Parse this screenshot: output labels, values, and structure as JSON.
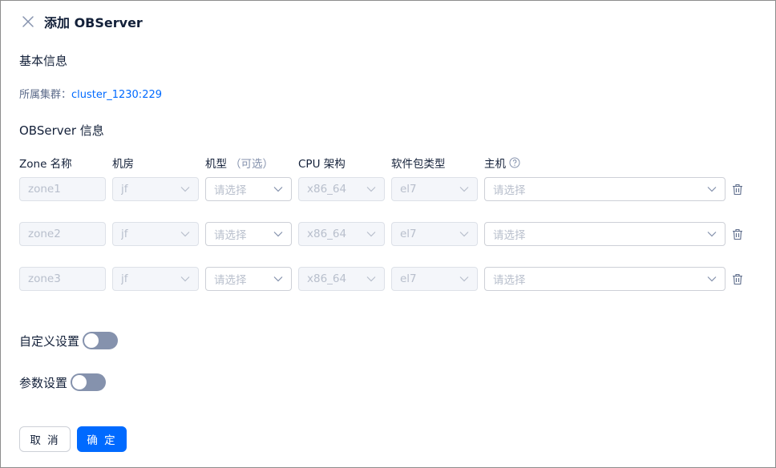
{
  "header": {
    "title": "添加 OBServer",
    "close_icon": "close-icon"
  },
  "basic_info": {
    "section_title": "基本信息",
    "cluster_label": "所属集群：",
    "cluster_value": "cluster_1230:229"
  },
  "observer_info": {
    "section_title": "OBServer 信息",
    "columns": {
      "zone_name": "Zone 名称",
      "idc": "机房",
      "model": "机型",
      "model_optional": "（可选）",
      "cpu_arch": "CPU 架构",
      "package_type": "软件包类型",
      "host": "主机"
    },
    "rows": [
      {
        "zone": "zone1",
        "idc": "jf",
        "model_placeholder": "请选择",
        "cpu": "x86_64",
        "package": "el7",
        "host_placeholder": "请选择"
      },
      {
        "zone": "zone2",
        "idc": "jf",
        "model_placeholder": "请选择",
        "cpu": "x86_64",
        "package": "el7",
        "host_placeholder": "请选择"
      },
      {
        "zone": "zone3",
        "idc": "jf",
        "model_placeholder": "请选择",
        "cpu": "x86_64",
        "package": "el7",
        "host_placeholder": "请选择"
      }
    ]
  },
  "custom_settings": {
    "label": "自定义设置",
    "enabled": false
  },
  "param_settings": {
    "label": "参数设置",
    "enabled": false
  },
  "footer": {
    "cancel_label": "取 消",
    "confirm_label": "确 定"
  },
  "colors": {
    "primary": "#006aff",
    "toggle_off": "#8592ad",
    "text": "#132039",
    "placeholder": "#b8bfcc"
  }
}
